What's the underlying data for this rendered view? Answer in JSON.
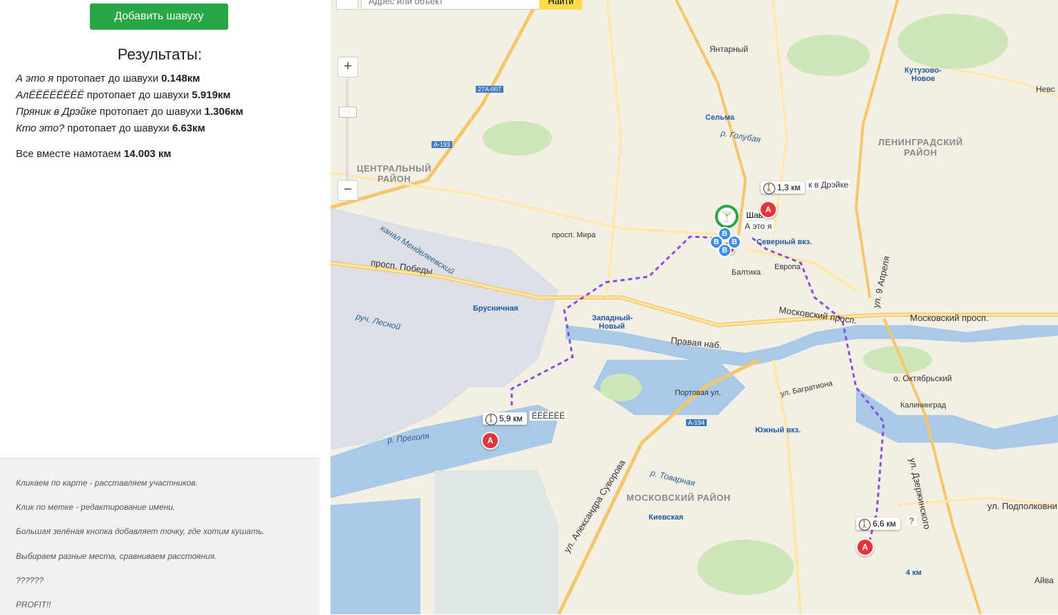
{
  "sidebar": {
    "add_button": "Добавить шавуху",
    "results_title": "Результаты:",
    "results": [
      {
        "name": "А это я",
        "text": " протопает до шавухи ",
        "distance": "0.148км"
      },
      {
        "name": "АлЁЁЁЁЁЁЁЁ",
        "text": " протопает до шавухи ",
        "distance": "5.919км"
      },
      {
        "name": "Пряник в Дрэйке",
        "text": " протопает до шавухи ",
        "distance": "1.306км"
      },
      {
        "name": "Кто это?",
        "text": " протопает до шавухи ",
        "distance": "6.63км"
      }
    ],
    "total_text": "Все вместе намотаем ",
    "total_value": "14.003 км",
    "help": [
      "Кликаем по карте - расставляем участников.",
      "Клик по метке - редактирование имени.",
      "Большая зелёная кнопка добавляет точку, где хотим кушать.",
      "Выбираем разные места, сравниваем расстояния.",
      "??????",
      "PROFIT!!"
    ]
  },
  "map": {
    "search_placeholder": "Адрес или объект",
    "search_button": "Найти",
    "zoom_in": "+",
    "zoom_out": "−",
    "districts": [
      "ЦЕНТРАЛЬНЫЙ",
      "РАЙОН",
      "ЛЕНИНГРАДСКИЙ",
      "РАЙОН",
      "МОСКОВСКИЙ РАЙОН"
    ],
    "labels": {
      "yantarny": "Янтарный",
      "kutuzovo": "Кутузово-",
      "kutuzovo2": "Новое",
      "selma": "Сельма",
      "brusnichnaya": "Брусничная",
      "zapadny": "Западный-",
      "zapadny2": "Новый",
      "baltika": "Балтика",
      "evropa": "Европа",
      "severny": "Северный вкз.",
      "yuzhny": "Южный вкз.",
      "kievskaya": "Киевская",
      "kaliningrad": "Калининград",
      "oktyabrsky": "о. Октябрьский",
      "km4": "4 км",
      "nevskoe": "Невс",
      "aivaz": "Айва",
      "prosp_pobedy": "просп. Победы",
      "moskovsky": "Московский просп.",
      "moskovsky2": "Московский просп.",
      "pregolya": "р. Преголя",
      "golubaya": "р. Голубая",
      "pravaya": "Правая наб.",
      "prosp_mira": "просп. Мира",
      "dzerzhinskogo": "ул. Дзержинского",
      "suvorova": "ул. Александра Суворова",
      "aprelya": "ул. 9 Апреля",
      "podpolkovnika": "ул. Подполковни",
      "lesnoy": "руч. Лесной",
      "mendeleev": "канал Менделеевский",
      "bagrationa": "ул. Багратиона",
      "portovaya": "Портовая ул.",
      "tovarnaya": "р. Товарная",
      "a194": "A-194",
      "a193": "A-193",
      "r27": "27А-007"
    },
    "shav_label": "Шава",
    "markers": [
      {
        "callout": "1,3 км",
        "name": "к в Дрэйке",
        "pin": "A"
      },
      {
        "callout": "5,9 км",
        "name": "ЁЁЁЁЁЁ",
        "pin": "A"
      },
      {
        "callout": "6,6 км",
        "name": "?",
        "pin": "A"
      },
      {
        "callout": "",
        "name": "А это я",
        "pin": "A"
      }
    ],
    "b_pin": "B"
  }
}
